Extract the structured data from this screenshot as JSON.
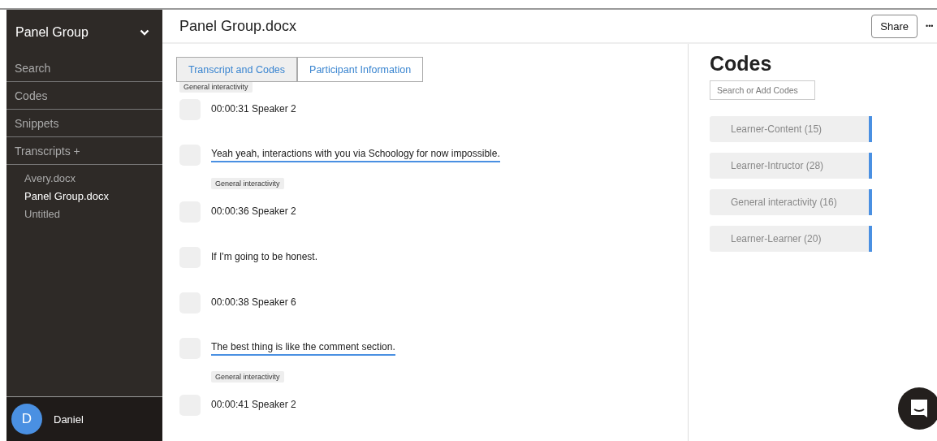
{
  "sidebar": {
    "title": "Panel Group",
    "nav": [
      {
        "label": "Search"
      },
      {
        "label": "Codes"
      },
      {
        "label": "Snippets"
      },
      {
        "label": "Transcripts +"
      }
    ],
    "files": [
      {
        "label": "Avery.docx",
        "selected": false
      },
      {
        "label": "Panel Group.docx",
        "selected": true
      },
      {
        "label": "Untitled",
        "selected": false
      }
    ],
    "user": {
      "initial": "D",
      "name": "Daniel"
    }
  },
  "document": {
    "title": "Panel Group.docx",
    "share": "Share",
    "more": "•••"
  },
  "tabs": [
    {
      "label": "Transcript and Codes",
      "selected": true
    },
    {
      "label": "Participant Information",
      "selected": false
    }
  ],
  "transcript": {
    "leading_tag": "General interactivity",
    "lines": [
      {
        "text": "00:00:31 Speaker 2",
        "checked": false,
        "coded": false
      },
      {
        "text": "Yeah yeah, interactions with you via Schoology for now impossible.",
        "checked": false,
        "coded": true,
        "tags": [
          "General interactivity"
        ]
      },
      {
        "text": "00:00:36 Speaker 2",
        "checked": false,
        "coded": false
      },
      {
        "text": "If I'm going to be honest.",
        "checked": false,
        "coded": false
      },
      {
        "text": "00:00:38 Speaker 6",
        "checked": false,
        "coded": false
      },
      {
        "text": "The best thing is like the comment section.",
        "checked": false,
        "coded": true,
        "tags": [
          "General interactivity"
        ]
      },
      {
        "text": "00:00:41 Speaker 2",
        "checked": false,
        "coded": false
      }
    ]
  },
  "codes": {
    "title": "Codes",
    "placeholder": "Search or Add Codes",
    "items": [
      {
        "label": "Learner-Content (15)",
        "color": "#4a90e2"
      },
      {
        "label": "Learner-Intructor (28)",
        "color": "#4a90e2"
      },
      {
        "label": "General interactivity (16)",
        "color": "#4a90e2"
      },
      {
        "label": "Learner-Learner (20)",
        "color": "#4a90e2"
      }
    ]
  }
}
